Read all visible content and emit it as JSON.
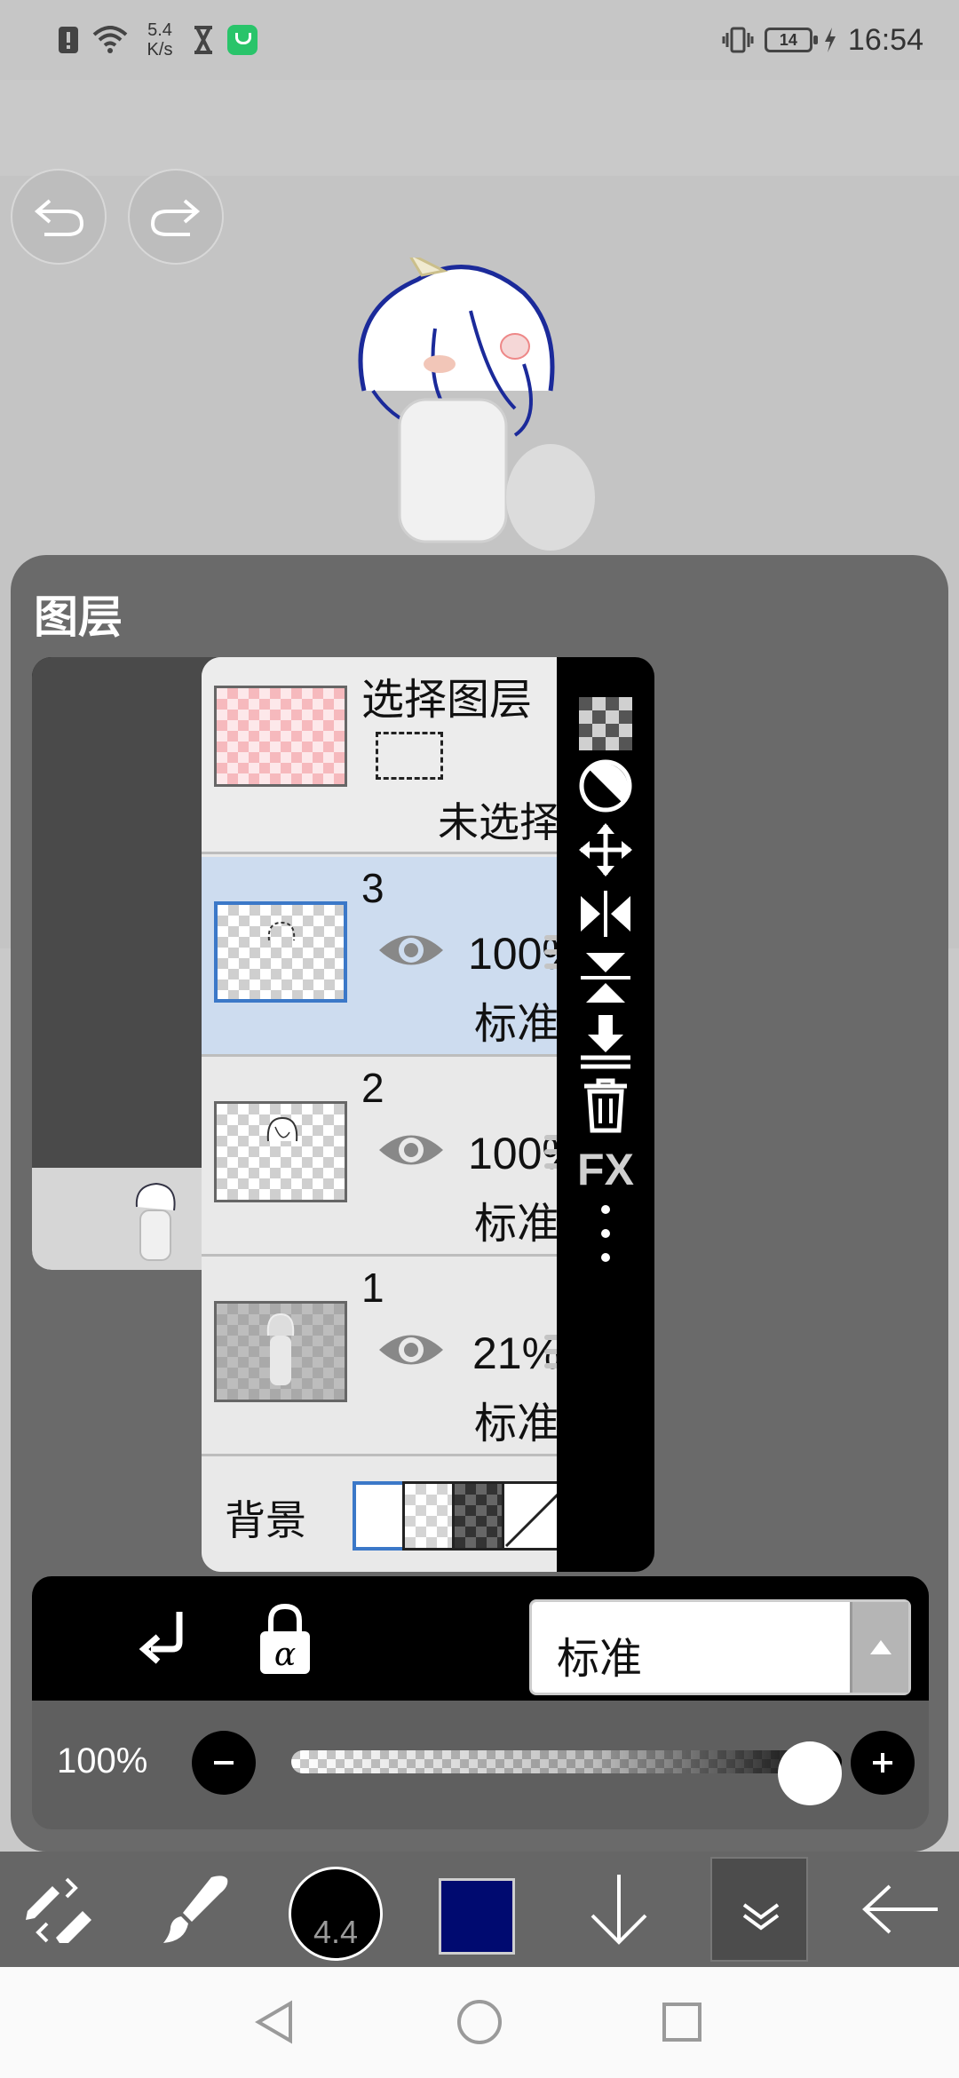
{
  "status_bar": {
    "net_speed_value": "5.4",
    "net_speed_unit": "K/s",
    "battery": "14",
    "time": "16:54"
  },
  "layers_panel": {
    "title": "图层",
    "selection_layer": {
      "title": "选择图层",
      "status": "未选择"
    },
    "layers": [
      {
        "number": "3",
        "opacity": "100%",
        "blend": "标准",
        "active": true
      },
      {
        "number": "2",
        "opacity": "100%",
        "blend": "标准",
        "active": false
      },
      {
        "number": "1",
        "opacity": "21%",
        "blend": "标准",
        "active": false
      }
    ],
    "background": {
      "label": "背景",
      "selected": "white"
    },
    "side_tools": {
      "fx_label": "FX"
    },
    "blend_mode": {
      "value": "标准"
    },
    "opacity": {
      "value_text": "100%",
      "value": 1.0
    }
  },
  "bottom_toolbar": {
    "brush_size": "4.4",
    "color": "#000a70"
  },
  "colors": {
    "panel_bg": "#666666",
    "active_row": "#cddcef",
    "selected_border": "#3b78c8",
    "brush_color": "#000a70"
  }
}
